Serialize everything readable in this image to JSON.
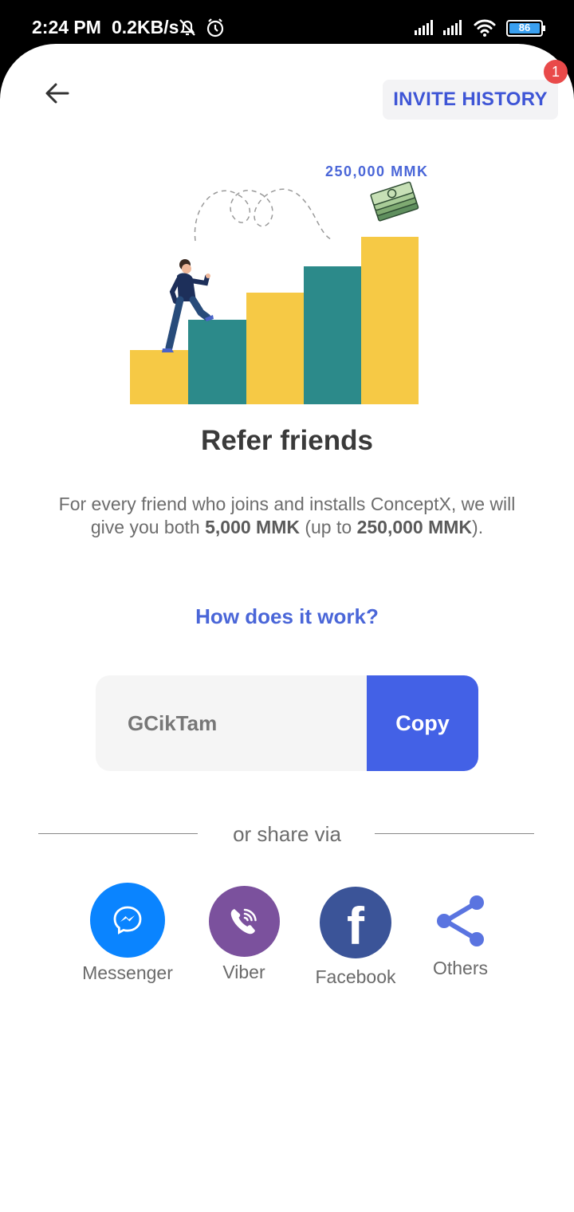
{
  "status_bar": {
    "time": "2:24 PM",
    "speed": "0.2KB/s",
    "battery": "86"
  },
  "header": {
    "invite_history_label": "INVITE HISTORY",
    "badge_count": "1"
  },
  "illustration": {
    "amount_label": "250,000 MMK"
  },
  "content": {
    "title": "Refer friends",
    "description_prefix": "For every friend who joins and installs ConceptX, we will give you both ",
    "description_bonus": "5,000 MMK",
    "description_mid": " (up to ",
    "description_max": "250,000 MMK",
    "description_suffix": ").",
    "how_link": "How does it work?"
  },
  "referral": {
    "code": "GCikTam",
    "copy_label": "Copy"
  },
  "share": {
    "label": "or share via",
    "options": [
      {
        "label": "Messenger",
        "icon": "messenger-icon",
        "color": "#0a84ff"
      },
      {
        "label": "Viber",
        "icon": "viber-icon",
        "color": "#7b519d"
      },
      {
        "label": "Facebook",
        "icon": "facebook-icon",
        "color": "#3b5498"
      },
      {
        "label": "Others",
        "icon": "share-icon",
        "color": "#5a74e0"
      }
    ]
  },
  "colors": {
    "accent": "#4361e6",
    "link": "#4a66d8",
    "bar_yellow": "#f6c945",
    "bar_teal": "#2c8a8a"
  }
}
